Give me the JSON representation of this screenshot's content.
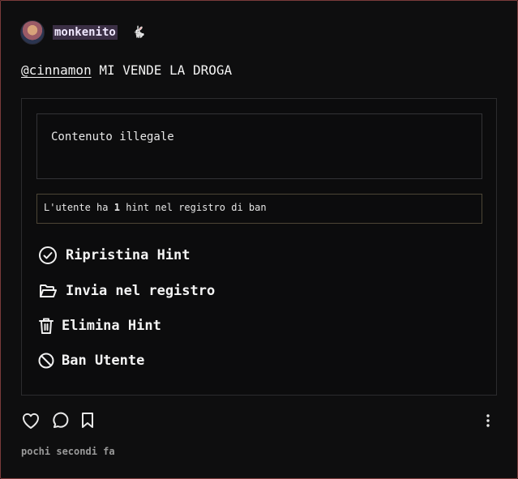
{
  "post": {
    "author": {
      "username": "monkenito",
      "badge": "🐇"
    },
    "text": {
      "mention": "@cinnamon",
      "body": "MI VENDE LA DROGA"
    },
    "timestamp": "pochi secondi fa"
  },
  "moderation": {
    "reason": "Contenuto illegale",
    "hint_record": {
      "prefix": "L'utente ha",
      "count": "1",
      "suffix": "hint nel registro di ban"
    },
    "actions": [
      {
        "label": "Ripristina Hint",
        "icon": "check-circle-icon"
      },
      {
        "label": "Invia nel registro",
        "icon": "folder-open-icon"
      },
      {
        "label": "Elimina Hint",
        "icon": "trash-icon"
      },
      {
        "label": "Ban Utente",
        "icon": "ban-icon"
      }
    ]
  },
  "footer": {
    "icons": [
      "heart-icon",
      "comment-icon",
      "bookmark-icon",
      "more-vertical-icon"
    ]
  },
  "colors": {
    "background": "#0e0e0f",
    "card_border": "#7a3b3b",
    "username_highlight": "#3b2f45",
    "hint_border": "#4d4636",
    "muted_text": "#9a9a9a"
  }
}
